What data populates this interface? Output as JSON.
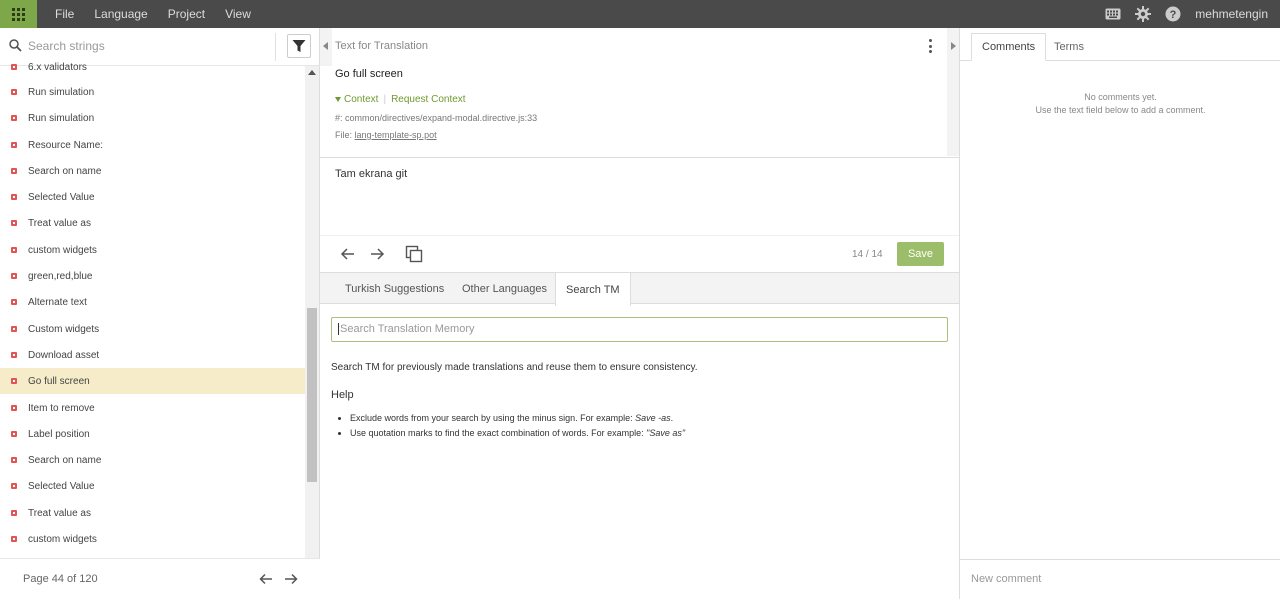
{
  "topbar": {
    "menu": [
      "File",
      "Language",
      "Project",
      "View"
    ],
    "username": "mehmetengin"
  },
  "left": {
    "search_placeholder": "Search strings",
    "items": [
      {
        "label": "6.x validators",
        "active": false
      },
      {
        "label": "Run simulation",
        "active": false
      },
      {
        "label": "Run simulation",
        "active": false
      },
      {
        "label": "Resource Name:",
        "active": false
      },
      {
        "label": "Search on name",
        "active": false
      },
      {
        "label": "Selected Value",
        "active": false
      },
      {
        "label": "Treat value as",
        "active": false
      },
      {
        "label": "custom widgets",
        "active": false
      },
      {
        "label": "green,red,blue",
        "active": false
      },
      {
        "label": "Alternate text",
        "active": false
      },
      {
        "label": "Custom widgets",
        "active": false
      },
      {
        "label": "Download asset",
        "active": false
      },
      {
        "label": "Go full screen",
        "active": true
      },
      {
        "label": "Item to remove",
        "active": false
      },
      {
        "label": "Label position",
        "active": false
      },
      {
        "label": "Search on name",
        "active": false
      },
      {
        "label": "Selected Value",
        "active": false
      },
      {
        "label": "Treat value as",
        "active": false
      },
      {
        "label": "custom widgets",
        "active": false
      }
    ],
    "pager": "Page 44 of 120"
  },
  "editor": {
    "title": "Text for Translation",
    "source": "Go full screen",
    "context_label": "Context",
    "request_context_label": "Request Context",
    "reference": "#: common/directives/expand-modal.directive.js:33",
    "file_label": "File:",
    "file_name": "lang-template-sp.pot",
    "translation": "Tam ekrana git",
    "counter": "14 / 14",
    "save_label": "Save"
  },
  "tabs": [
    "Turkish Suggestions",
    "Other Languages",
    "Search TM"
  ],
  "active_tab": "Search TM",
  "tm": {
    "placeholder": "Search Translation Memory",
    "hint": "Search TM for previously made translations and reuse them to ensure consistency.",
    "help_title": "Help",
    "help1_prefix": "Exclude words from your search by using the minus sign. For example: ",
    "help1_example": "Save -as",
    "help1_suffix": ".",
    "help2_prefix": "Use quotation marks to find the exact combination of words. For example: ",
    "help2_example": "\"Save as\""
  },
  "comments": {
    "tab_comments": "Comments",
    "tab_terms": "Terms",
    "empty_line1": "No comments yet.",
    "empty_line2": "Use the text field below to add a comment.",
    "new_comment_placeholder": "New comment"
  },
  "colors": {
    "topbar": "#4a4a4a",
    "accent_green": "#7da748",
    "save_button": "#9cbd69",
    "active_row": "#f6ecca",
    "untranslated_mark": "#e05555"
  }
}
